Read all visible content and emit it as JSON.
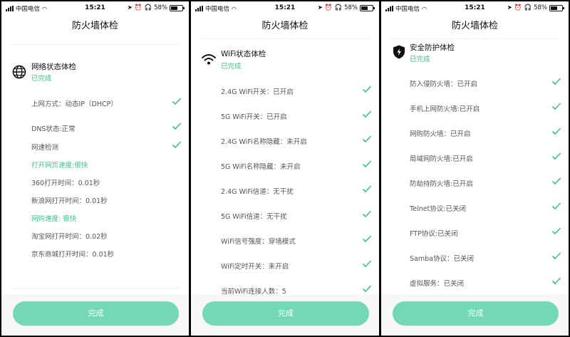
{
  "status_bar": {
    "carrier": "中国电信",
    "time": "15:21",
    "battery": "58%"
  },
  "colors": {
    "accent": "#3dbf86",
    "button": "#72d9b4"
  },
  "screens": [
    {
      "title": "防火墙体检",
      "section_title": "网络状态体检",
      "section_status": "已完成",
      "section_icon": "globe-icon",
      "rows": [
        {
          "label": "上网方式：动态IP（DHCP）",
          "checked": true,
          "highlight": false
        },
        {
          "label": "DNS状态:正常",
          "checked": true,
          "highlight": false
        },
        {
          "label": "网速检测",
          "checked": true,
          "highlight": false
        },
        {
          "label": "打开网页速度:很快",
          "checked": false,
          "highlight": true
        },
        {
          "label": "360打开时间：0.01秒",
          "checked": false,
          "highlight": false
        },
        {
          "label": "新浪网打开时间：0.01秒",
          "checked": false,
          "highlight": false
        },
        {
          "label": "网购速度: 很快",
          "checked": false,
          "highlight": true
        },
        {
          "label": "淘宝网打开时间：0.02秒",
          "checked": false,
          "highlight": false
        },
        {
          "label": "京东商城打开时间：0.01秒",
          "checked": false,
          "highlight": false
        }
      ],
      "button": "完成"
    },
    {
      "title": "防火墙体检",
      "section_title": "WiFi状态体检",
      "section_status": "已完成",
      "section_icon": "wifi-icon",
      "rows": [
        {
          "label": "2.4G WiFi开关：已开启",
          "checked": true
        },
        {
          "label": "5G WiFi开关：已开启",
          "checked": true
        },
        {
          "label": "2.4G WiFi名称隐藏：未开启",
          "checked": true
        },
        {
          "label": "5G WiFi名称隐藏：未开启",
          "checked": true
        },
        {
          "label": "2.4G WiFi信道：无干扰",
          "checked": true
        },
        {
          "label": "5G WiFi信道：无干扰",
          "checked": true
        },
        {
          "label": "WiFi信号强度：穿墙模式",
          "checked": true
        },
        {
          "label": "WiFi定时开关：未开启",
          "checked": true
        },
        {
          "label": "当前WiFi连接人数：5",
          "checked": true
        }
      ],
      "button": "完成"
    },
    {
      "title": "防火墙体检",
      "section_title": "安全防护体检",
      "section_status": "已完成",
      "section_icon": "shield-icon",
      "rows": [
        {
          "label": "防入侵防火墙：已开启",
          "checked": true
        },
        {
          "label": "手机上网防火墙:已开启",
          "checked": true
        },
        {
          "label": "网购防火墙：已开启",
          "checked": true
        },
        {
          "label": "局域网防火墙:已开启",
          "checked": true
        },
        {
          "label": "防劫持防火墙:已开启",
          "checked": true
        },
        {
          "label": "Telnet协议:已关闭",
          "checked": true
        },
        {
          "label": "FTP协议:已关闭",
          "checked": true
        },
        {
          "label": "Samba协议：已关闭",
          "checked": true
        },
        {
          "label": "虚拟服务：已关闭",
          "checked": true
        }
      ],
      "button": "完成"
    }
  ]
}
